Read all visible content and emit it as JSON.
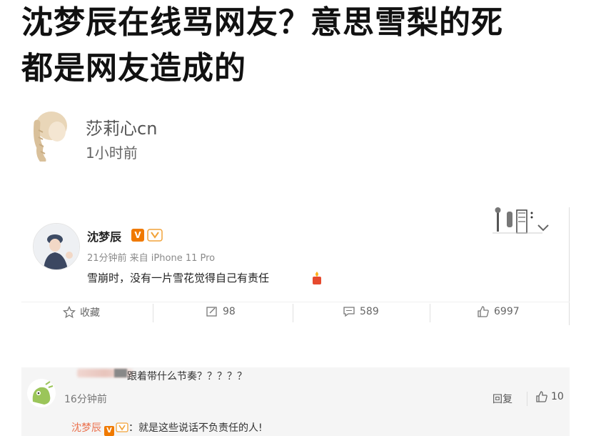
{
  "headline": {
    "line1": "沈梦辰在线骂网友？意思雪梨的死",
    "line2": "都是网友造成的"
  },
  "author": {
    "name": "莎莉心cn",
    "time": "1小时前"
  },
  "post": {
    "user": "沈梦辰",
    "verified_badge": "V",
    "meta": "21分钟前 来自 iPhone 11 Pro",
    "text": "雪崩时，没有一片雪花觉得自己有责任",
    "actions": {
      "favorite": "收藏",
      "repost": "98",
      "comment": "589",
      "like": "6997"
    }
  },
  "comment": {
    "text": "跟着带什么节奏？？？？？",
    "time": "16分钟前",
    "reply_label": "回复",
    "like_count": "10",
    "subreply": {
      "user": "沈梦辰",
      "verified_badge": "V",
      "text": "：就是这些说话不负责任的人!"
    }
  },
  "colors": {
    "accent_orange": "#f07a00",
    "subreply_name": "#eb7350"
  }
}
